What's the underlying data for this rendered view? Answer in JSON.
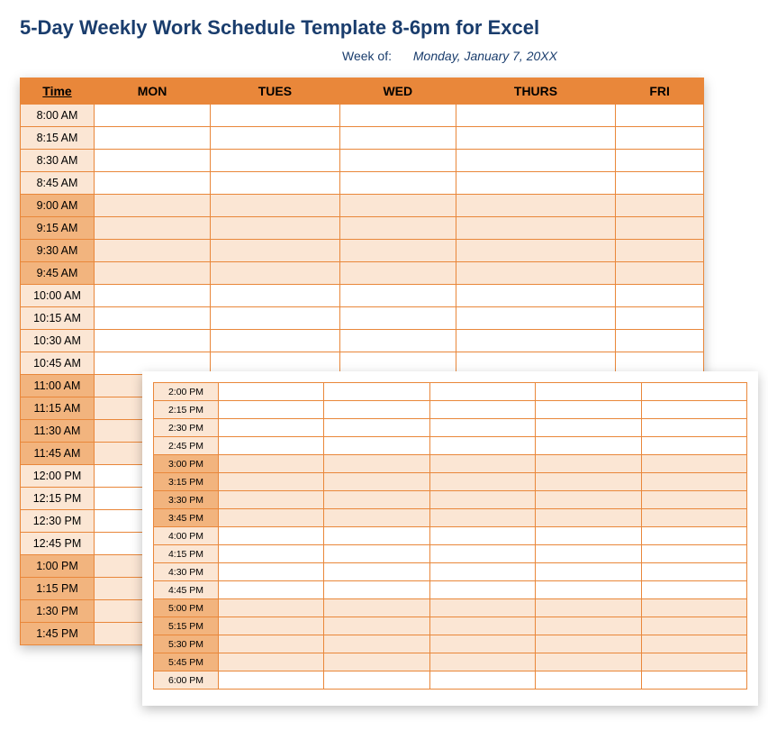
{
  "title": "5-Day Weekly Work Schedule Template 8-6pm for Excel",
  "week_of_label": "Week of:",
  "week_of_value": "Monday, January 7, 20XX",
  "headers": {
    "time": "Time",
    "days": [
      "MON",
      "TUES",
      "WED",
      "THURS",
      "FRI"
    ]
  },
  "back_rows": [
    {
      "time": "8:00 AM",
      "shade": "light"
    },
    {
      "time": "8:15 AM",
      "shade": "light"
    },
    {
      "time": "8:30 AM",
      "shade": "light"
    },
    {
      "time": "8:45 AM",
      "shade": "light"
    },
    {
      "time": "9:00 AM",
      "shade": "dark"
    },
    {
      "time": "9:15 AM",
      "shade": "dark"
    },
    {
      "time": "9:30 AM",
      "shade": "dark"
    },
    {
      "time": "9:45 AM",
      "shade": "dark"
    },
    {
      "time": "10:00 AM",
      "shade": "light"
    },
    {
      "time": "10:15 AM",
      "shade": "light"
    },
    {
      "time": "10:30 AM",
      "shade": "light"
    },
    {
      "time": "10:45 AM",
      "shade": "light"
    },
    {
      "time": "11:00 AM",
      "shade": "dark"
    },
    {
      "time": "11:15 AM",
      "shade": "dark"
    },
    {
      "time": "11:30 AM",
      "shade": "dark"
    },
    {
      "time": "11:45 AM",
      "shade": "dark"
    },
    {
      "time": "12:00 PM",
      "shade": "light"
    },
    {
      "time": "12:15 PM",
      "shade": "light"
    },
    {
      "time": "12:30 PM",
      "shade": "light"
    },
    {
      "time": "12:45 PM",
      "shade": "light"
    },
    {
      "time": "1:00 PM",
      "shade": "dark"
    },
    {
      "time": "1:15 PM",
      "shade": "dark"
    },
    {
      "time": "1:30 PM",
      "shade": "dark"
    },
    {
      "time": "1:45 PM",
      "shade": "dark"
    }
  ],
  "front_rows": [
    {
      "time": "2:00 PM",
      "shade": "light"
    },
    {
      "time": "2:15 PM",
      "shade": "light"
    },
    {
      "time": "2:30 PM",
      "shade": "light"
    },
    {
      "time": "2:45 PM",
      "shade": "light"
    },
    {
      "time": "3:00 PM",
      "shade": "dark"
    },
    {
      "time": "3:15 PM",
      "shade": "dark"
    },
    {
      "time": "3:30 PM",
      "shade": "dark"
    },
    {
      "time": "3:45 PM",
      "shade": "dark"
    },
    {
      "time": "4:00 PM",
      "shade": "light"
    },
    {
      "time": "4:15 PM",
      "shade": "light"
    },
    {
      "time": "4:30 PM",
      "shade": "light"
    },
    {
      "time": "4:45 PM",
      "shade": "light"
    },
    {
      "time": "5:00 PM",
      "shade": "dark"
    },
    {
      "time": "5:15 PM",
      "shade": "dark"
    },
    {
      "time": "5:30 PM",
      "shade": "dark"
    },
    {
      "time": "5:45 PM",
      "shade": "dark"
    },
    {
      "time": "6:00 PM",
      "shade": "light"
    }
  ]
}
